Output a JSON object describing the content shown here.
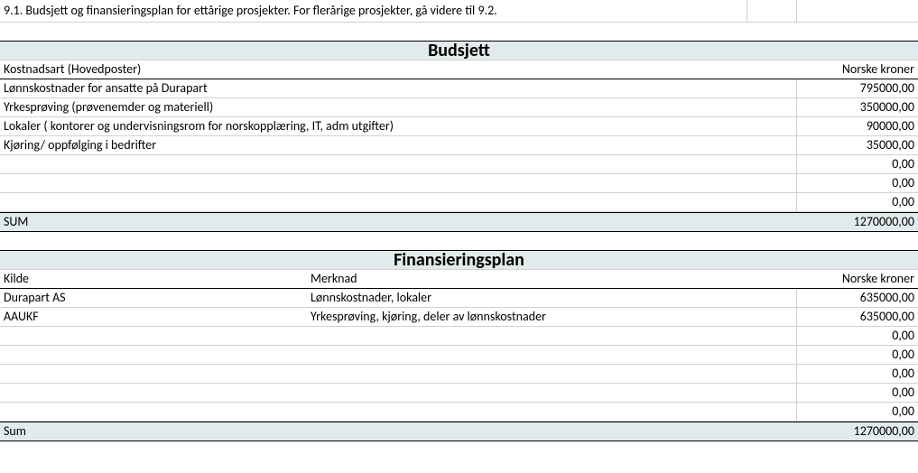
{
  "topNote": "9.1. Budsjett og finansieringsplan for ettårige prosjekter. For flerårige prosjekter, gå videre til 9.2.",
  "budget": {
    "title": "Budsjett",
    "col1": "Kostnadsart  (Hovedposter)",
    "col2": "Norske kroner",
    "rows": [
      {
        "name": "Lønnskostnader for ansatte på Durapart",
        "amount": "795000,00"
      },
      {
        "name": "Yrkesprøving (prøvenemder og materiell)",
        "amount": "350000,00"
      },
      {
        "name": "Lokaler ( kontorer og undervisningsrom for norskopplæring, IT, adm utgifter)",
        "amount": "90000,00"
      },
      {
        "name": "Kjøring/ oppfølging i bedrifter",
        "amount": "35000,00"
      },
      {
        "name": "",
        "amount": "0,00"
      },
      {
        "name": "",
        "amount": "0,00"
      },
      {
        "name": "",
        "amount": "0,00"
      }
    ],
    "sumLabel": "SUM",
    "sumAmount": "1270000,00"
  },
  "financing": {
    "title": "Finansieringsplan",
    "col1": "Kilde",
    "col2": "Merknad",
    "col3": "Norske kroner",
    "rows": [
      {
        "source": "Durapart AS",
        "note": "Lønnskostnader, lokaler",
        "amount": "635000,00"
      },
      {
        "source": "AAUKF",
        "note": "Yrkesprøving, kjøring, deler av lønnskostnader",
        "amount": "635000,00"
      },
      {
        "source": "",
        "note": "",
        "amount": "0,00"
      },
      {
        "source": "",
        "note": "",
        "amount": "0,00"
      },
      {
        "source": "",
        "note": "",
        "amount": "0,00"
      },
      {
        "source": "",
        "note": "",
        "amount": "0,00"
      },
      {
        "source": "",
        "note": "",
        "amount": "0,00"
      }
    ],
    "sumLabel": "Sum",
    "sumAmount": "1270000,00"
  }
}
